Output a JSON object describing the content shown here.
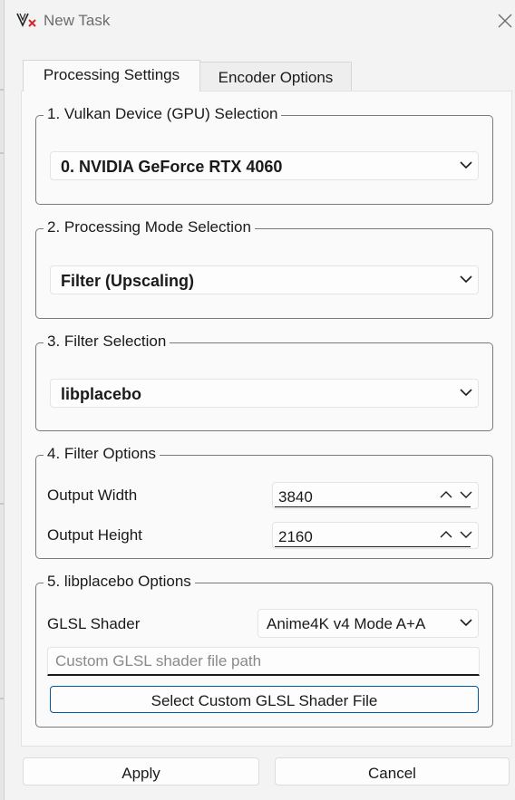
{
  "window": {
    "title": "New Task"
  },
  "tabs": [
    {
      "label": "Processing Settings",
      "active": true
    },
    {
      "label": "Encoder Options",
      "active": false
    }
  ],
  "groups": {
    "device": {
      "title": "1. Vulkan Device (GPU) Selection",
      "selected": "0. NVIDIA GeForce RTX 4060"
    },
    "mode": {
      "title": "2. Processing Mode Selection",
      "selected": "Filter (Upscaling)"
    },
    "filter": {
      "title": "3. Filter Selection",
      "selected": "libplacebo"
    },
    "filter_options": {
      "title": "4. Filter Options",
      "output_width_label": "Output Width",
      "output_width_value": "3840",
      "output_height_label": "Output Height",
      "output_height_value": "2160"
    },
    "libplacebo_options": {
      "title": "5. libplacebo Options",
      "shader_label": "GLSL Shader",
      "shader_selected": "Anime4K v4 Mode A+A",
      "custom_path_placeholder": "Custom GLSL shader file path",
      "select_file_button": "Select Custom GLSL Shader File"
    }
  },
  "footer": {
    "apply_label": "Apply",
    "cancel_label": "Cancel"
  },
  "colors": {
    "accent_border": "#005a9e",
    "group_border": "#7a7a7a",
    "background": "#f3f3f3"
  },
  "icons": {
    "app": "video2x-logo-icon",
    "close": "close-icon",
    "dropdown": "chevron-down-icon",
    "up": "chevron-up-icon"
  }
}
